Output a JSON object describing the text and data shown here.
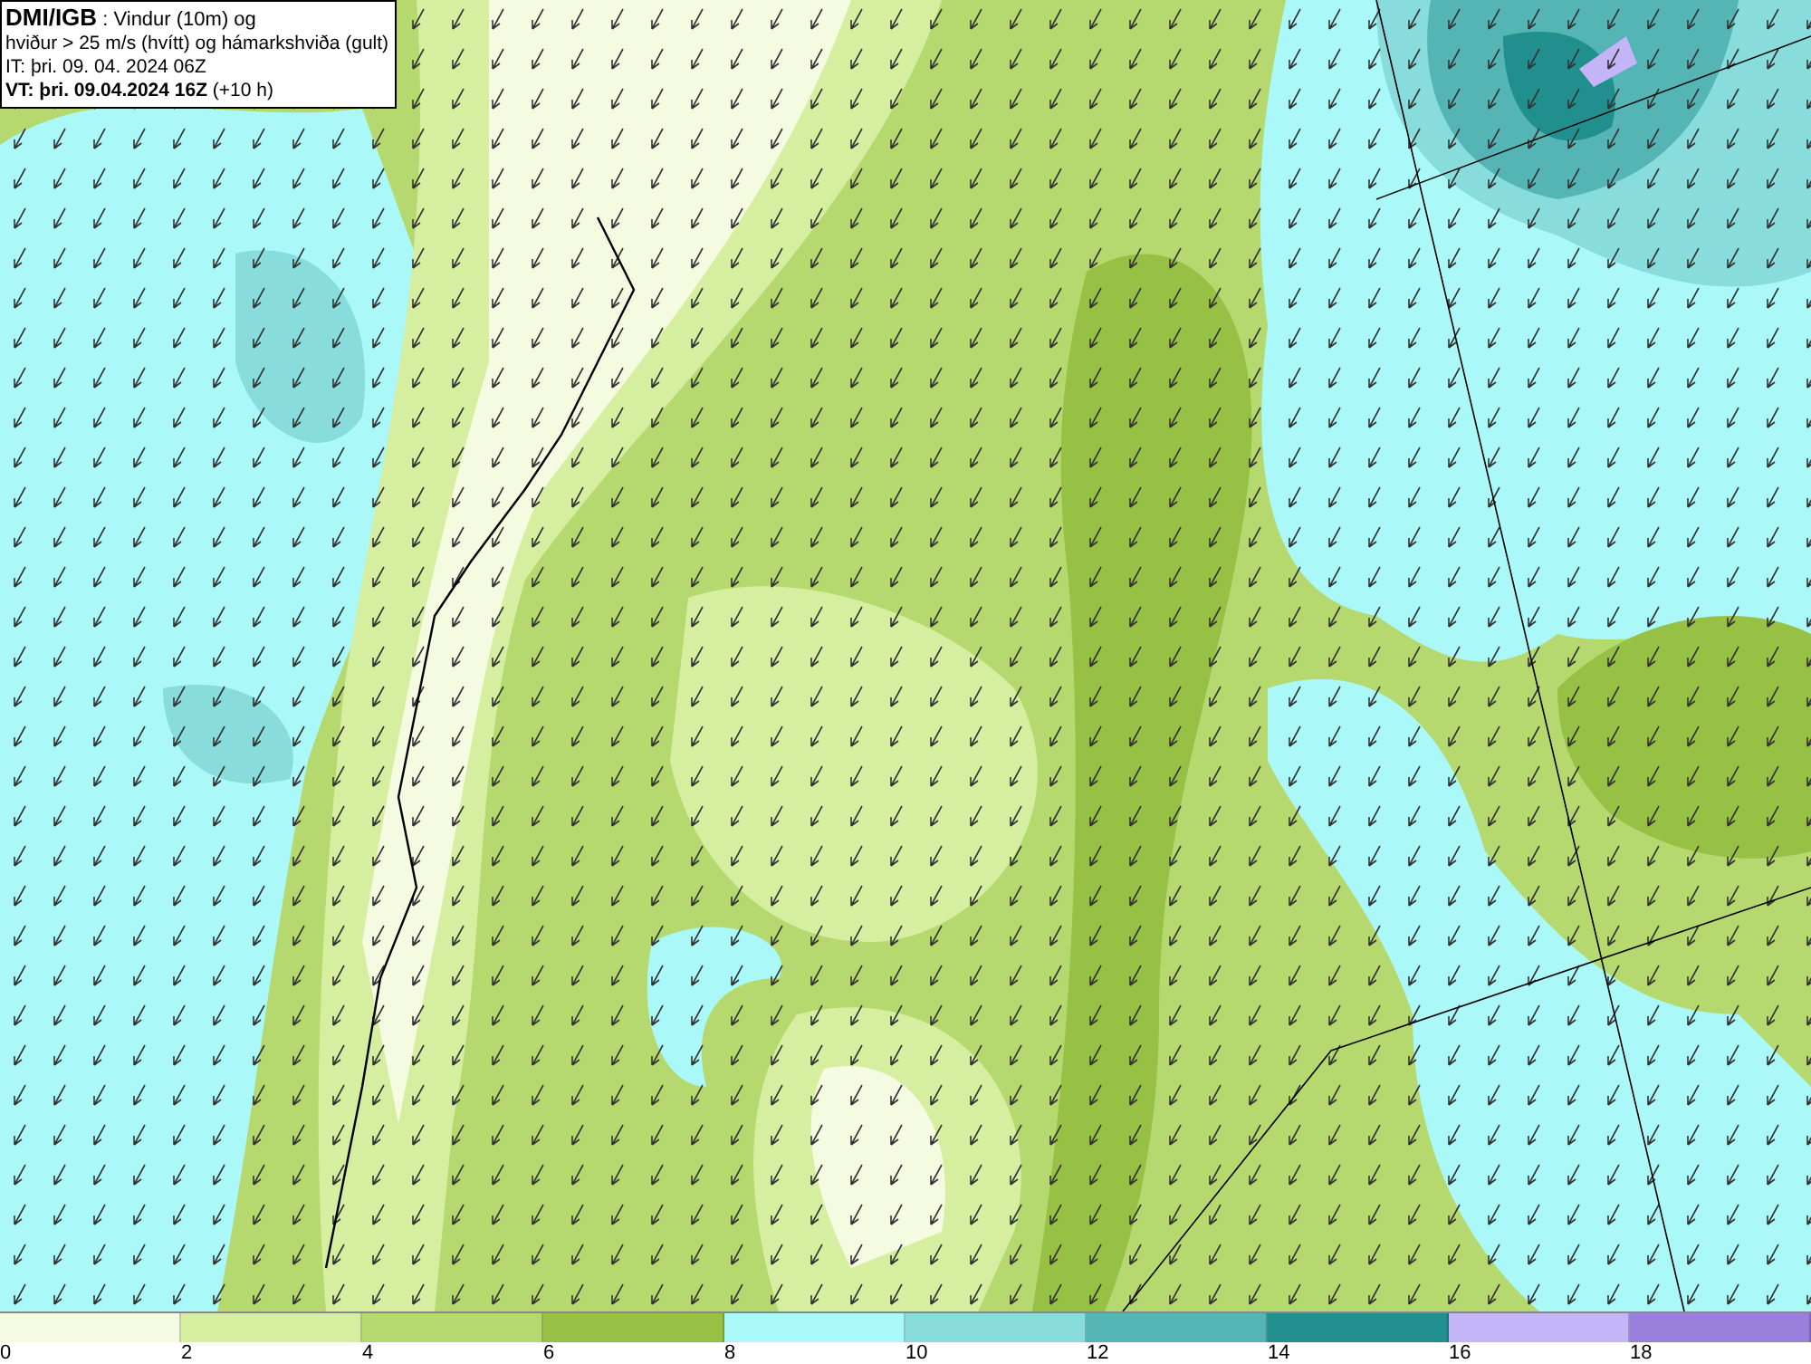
{
  "title_box": {
    "lines": [
      "**DMI/IGB** : Vindur (10m) og",
      "hviður > 25 m/s (hvítt) og hámarkshviða (gult)",
      "IT: þri. 09. 04. 2024 06Z",
      "**VT: þri. 09.04.2024 16Z** (+10 h)"
    ]
  },
  "legend": {
    "items": [
      {
        "label": "0",
        "color": "#f5fbe0"
      },
      {
        "label": "2",
        "color": "#d6eea0"
      },
      {
        "label": "4",
        "color": "#b5d96e"
      },
      {
        "label": "6",
        "color": "#97c145"
      },
      {
        "label": "8",
        "color": "#aaf8f8"
      },
      {
        "label": "10",
        "color": "#88dcdc"
      },
      {
        "label": "12",
        "color": "#55b5b5"
      },
      {
        "label": "14",
        "color": "#228f8f"
      },
      {
        "label": "16",
        "color": "#c4b4f8"
      },
      {
        "label": "18",
        "color": "#9a80dc"
      }
    ]
  }
}
